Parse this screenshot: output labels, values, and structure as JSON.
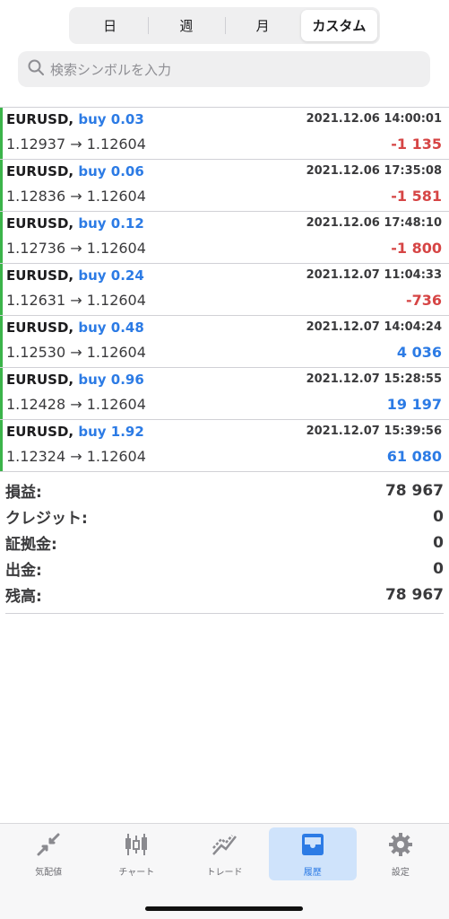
{
  "segments": [
    {
      "label": "日",
      "active": false
    },
    {
      "label": "週",
      "active": false
    },
    {
      "label": "月",
      "active": false
    },
    {
      "label": "カスタム",
      "active": true
    }
  ],
  "search": {
    "placeholder": "検索シンボルを入力",
    "icon": "search-icon"
  },
  "trades": [
    {
      "symbol": "EURUSD,",
      "side": "buy 0.03",
      "time": "2021.12.06 14:00:01",
      "prices": "1.12937 → 1.12604",
      "profit": "-1 135",
      "profit_type": "neg"
    },
    {
      "symbol": "EURUSD,",
      "side": "buy 0.06",
      "time": "2021.12.06 17:35:08",
      "prices": "1.12836 → 1.12604",
      "profit": "-1 581",
      "profit_type": "neg"
    },
    {
      "symbol": "EURUSD,",
      "side": "buy 0.12",
      "time": "2021.12.06 17:48:10",
      "prices": "1.12736 → 1.12604",
      "profit": "-1 800",
      "profit_type": "neg"
    },
    {
      "symbol": "EURUSD,",
      "side": "buy 0.24",
      "time": "2021.12.07 11:04:33",
      "prices": "1.12631 → 1.12604",
      "profit": "-736",
      "profit_type": "neg"
    },
    {
      "symbol": "EURUSD,",
      "side": "buy 0.48",
      "time": "2021.12.07 14:04:24",
      "prices": "1.12530 → 1.12604",
      "profit": "4 036",
      "profit_type": "pos"
    },
    {
      "symbol": "EURUSD,",
      "side": "buy 0.96",
      "time": "2021.12.07 15:28:55",
      "prices": "1.12428 → 1.12604",
      "profit": "19 197",
      "profit_type": "pos"
    },
    {
      "symbol": "EURUSD,",
      "side": "buy 1.92",
      "time": "2021.12.07 15:39:56",
      "prices": "1.12324 → 1.12604",
      "profit": "61 080",
      "profit_type": "pos"
    }
  ],
  "summary": [
    {
      "label": "損益:",
      "value": "78 967"
    },
    {
      "label": "クレジット:",
      "value": "0"
    },
    {
      "label": "証拠金:",
      "value": "0"
    },
    {
      "label": "出金:",
      "value": "0"
    },
    {
      "label": "残高:",
      "value": "78 967"
    }
  ],
  "tabbar": [
    {
      "label": "気配値",
      "icon": "quotes-icon",
      "active": false
    },
    {
      "label": "チャート",
      "icon": "candlestick-chart-icon",
      "active": false
    },
    {
      "label": "トレード",
      "icon": "trade-icon",
      "active": false
    },
    {
      "label": "履歴",
      "icon": "history-inbox-icon",
      "active": true
    },
    {
      "label": "設定",
      "icon": "gear-icon",
      "active": false
    }
  ],
  "colors": {
    "accent": "#2c7be5",
    "negative": "#d64545",
    "buy_bar": "#3bb44a"
  }
}
